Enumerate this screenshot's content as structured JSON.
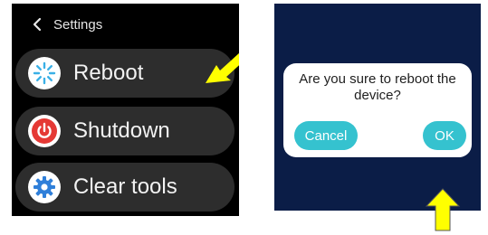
{
  "settings_screen": {
    "title": "Settings",
    "back_icon": "chevron-left-icon",
    "items": [
      {
        "label": "Reboot",
        "icon": "reboot-icon",
        "icon_color": "#3ab0e6"
      },
      {
        "label": "Shutdown",
        "icon": "power-icon",
        "icon_color": "#e53935"
      },
      {
        "label": "Clear tools",
        "icon": "gear-icon",
        "icon_color": "#2f7fd9"
      }
    ]
  },
  "reboot_dialog": {
    "message": "Are you sure to reboot the device?",
    "cancel_label": "Cancel",
    "ok_label": "OK"
  },
  "annotations": {
    "arrow_color": "#ffff00",
    "pointer_left": "arrow-pointing-at-reboot",
    "pointer_right": "arrow-pointing-up-at-ok"
  },
  "colors": {
    "dialog_background": "#0b1d47",
    "button_accent": "#35c2cf"
  }
}
